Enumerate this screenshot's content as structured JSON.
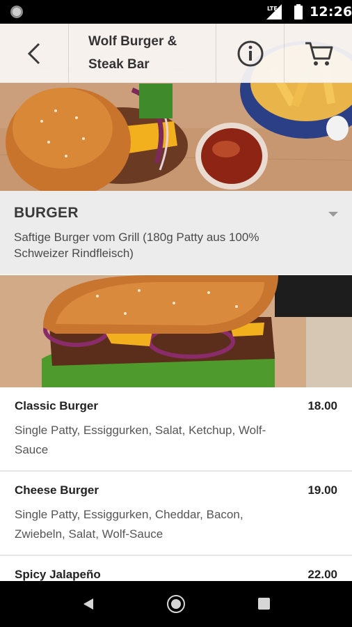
{
  "status_bar": {
    "network": "LTE",
    "time": "12:26"
  },
  "app_bar": {
    "title": "Wolf Burger & Steak Bar",
    "icons": [
      "back-arrow-icon",
      "info-icon",
      "cart-icon"
    ]
  },
  "category": {
    "title": "BURGER",
    "description": "Saftige Burger vom Grill (180g Patty aus 100% Schweizer Rindfleisch)"
  },
  "menu_items": [
    {
      "name": "Classic Burger",
      "price": "18.00",
      "description": "Single Patty, Essiggurken, Salat, Ketchup, Wolf-Sauce"
    },
    {
      "name": "Cheese Burger",
      "price": "19.00",
      "description": "Single Patty, Essiggurken, Cheddar, Bacon, Zwiebeln, Salat, Wolf-Sauce"
    },
    {
      "name": "Spicy Jalapeño",
      "price": "22.00",
      "description": ""
    }
  ],
  "nav_bar": {
    "icons": [
      "nav-back-icon",
      "nav-home-icon",
      "nav-recents-icon"
    ]
  },
  "colors": {
    "status_bar": "#000000",
    "app_bar": "#faf8f6",
    "category_bg": "#ececec",
    "text_dark": "#222222",
    "text_muted": "#555555"
  }
}
